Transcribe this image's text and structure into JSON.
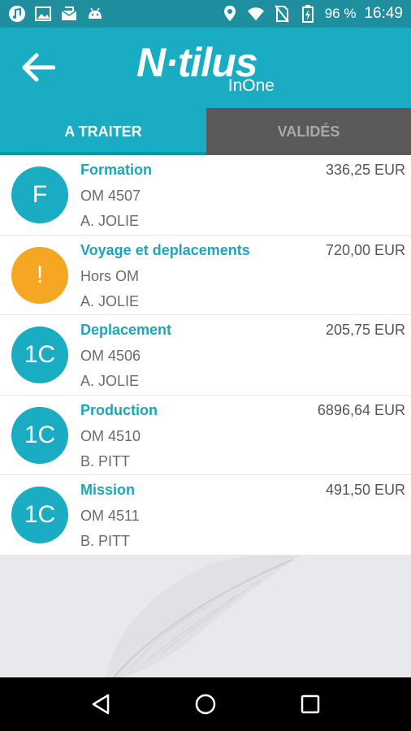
{
  "status_bar": {
    "battery": "96 %",
    "time": "16:49"
  },
  "header": {
    "logo_main": "N·tilus",
    "logo_sub": "InOne"
  },
  "tabs": [
    {
      "label": "A TRAITER",
      "active": true
    },
    {
      "label": "VALIDÉS",
      "active": false
    }
  ],
  "items": [
    {
      "avatar": "F",
      "avatar_color": "#19acc2",
      "title": "Formation",
      "line2": "OM 4507",
      "line3": "A. JOLIE",
      "amount": "336,25 EUR"
    },
    {
      "avatar": "!",
      "avatar_color": "#f5a623",
      "title": "Voyage et deplacements",
      "line2": "Hors OM",
      "line3": "A. JOLIE",
      "amount": "720,00 EUR"
    },
    {
      "avatar": "1C",
      "avatar_color": "#19acc2",
      "title": "Deplacement",
      "line2": "OM 4506",
      "line3": "A. JOLIE",
      "amount": "205,75 EUR"
    },
    {
      "avatar": "1C",
      "avatar_color": "#19acc2",
      "title": "Production",
      "line2": "OM 4510",
      "line3": "B. PITT",
      "amount": "6896,64 EUR"
    },
    {
      "avatar": "1C",
      "avatar_color": "#19acc2",
      "title": "Mission",
      "line2": "OM 4511",
      "line3": "B. PITT",
      "amount": "491,50 EUR"
    }
  ],
  "colors": {
    "primary": "#19acc2",
    "status_bar": "#1f8fa0",
    "warning": "#f5a623",
    "tab_inactive": "#5a5a5a"
  }
}
